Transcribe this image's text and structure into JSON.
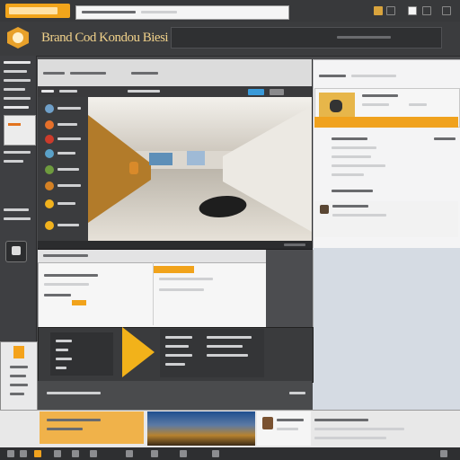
{
  "window": {
    "app_title": "Brand Cod Kondou Biesi"
  },
  "colors": {
    "accent": "#f2a51b",
    "header": "#3b3c3e",
    "link_blue": "#3a9ad9"
  },
  "icons": {
    "logo": "hexagon-logo-icon",
    "help": "help-icon",
    "play": "play-triangle-icon"
  }
}
